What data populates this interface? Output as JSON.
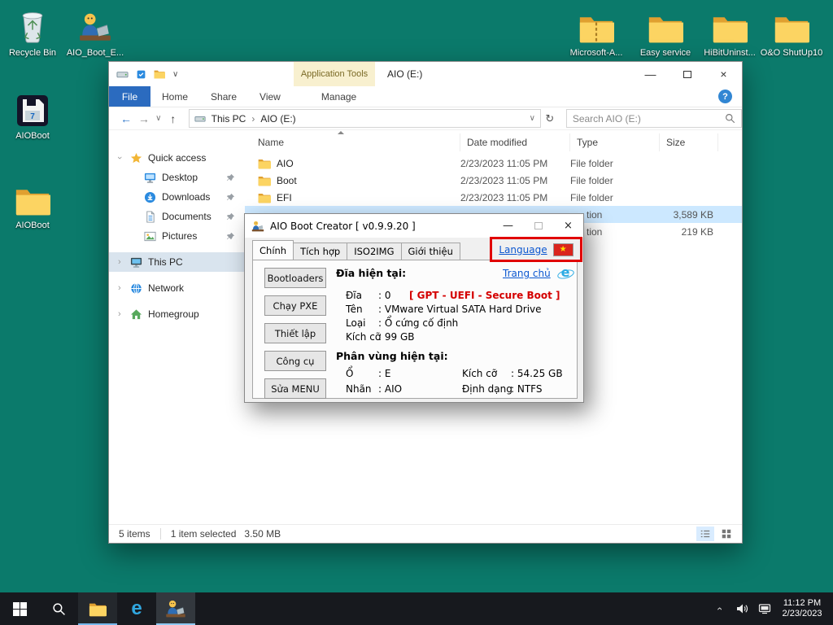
{
  "colors": {
    "desktop_bg": "#0b7a6b",
    "taskbar_bg": "#17191e",
    "highlight_box_red": "#e10000",
    "alert_text_red": "#d40000",
    "link_blue": "#0b57d0",
    "selection_blue": "#cce8ff",
    "file_tab_blue": "#2b6bbf",
    "flag_red": "#da251d",
    "flag_star_yellow": "#ffde00"
  },
  "glyphs": {
    "back": "←",
    "forward": "→",
    "recent": "∨",
    "up": "↑",
    "refresh": "↻",
    "crumb": "›",
    "dropdown": "∨",
    "minimize": "—",
    "close": "×",
    "help": "?",
    "star": "★",
    "edge_e": "e",
    "expander": "›"
  },
  "desktop_icons": {
    "recycle_bin": "Recycle Bin",
    "aio_boot_shortcut": "AIO_Boot_E...",
    "aioboot_app": "AIOBoot",
    "aioboot_folder": "AIOBoot",
    "microsoft": "Microsoft-A...",
    "easy_service": "Easy service",
    "hibit": "HiBitUninst...",
    "oo_shutup": "O&O ShutUp10"
  },
  "explorer": {
    "app_tools_label": "Application Tools",
    "window_title": "AIO (E:)",
    "ribbon": {
      "file": "File",
      "tabs": [
        "Home",
        "Share",
        "View"
      ],
      "manage": "Manage"
    },
    "breadcrumb": [
      "This PC",
      "AIO (E:)"
    ],
    "search_placeholder": "Search AIO (E:)",
    "sidebar": {
      "quick_access": "Quick access",
      "pinned": [
        "Desktop",
        "Downloads",
        "Documents",
        "Pictures"
      ],
      "this_pc": "This PC",
      "network": "Network",
      "homegroup": "Homegroup"
    },
    "columns": {
      "name": "Name",
      "date": "Date modified",
      "type": "Type",
      "size": "Size"
    },
    "rows": [
      {
        "name": "AIO",
        "date": "2/23/2023 11:05 PM",
        "type": "File folder",
        "size": ""
      },
      {
        "name": "Boot",
        "date": "2/23/2023 11:05 PM",
        "type": "File folder",
        "size": ""
      },
      {
        "name": "EFI",
        "date": "2/23/2023 11:05 PM",
        "type": "File folder",
        "size": ""
      },
      {
        "name": "",
        "date": "",
        "type": "tion",
        "size": "3,589 KB"
      },
      {
        "name": "",
        "date": "",
        "type": "tion",
        "size": "219 KB"
      }
    ],
    "status_left": "5 items",
    "status_selected": "1 item selected   3.50 MB"
  },
  "dialog": {
    "title": "AIO Boot Creator [ v0.9.9.20 ]",
    "tabs": [
      "Chính",
      "Tích hợp",
      "ISO2IMG",
      "Giới thiệu"
    ],
    "language_link": "Language",
    "buttons": [
      "Bootloaders",
      "Chạy PXE",
      "Thiết lập",
      "Công cụ",
      "Sửa MENU"
    ],
    "current_disk_heading": "Đĩa hiện tại:",
    "home_link": "Trang chủ",
    "disk": {
      "rows": [
        {
          "label": "Đĩa",
          "value": ": 0"
        },
        {
          "label": "Tên",
          "value": ": VMware Virtual SATA Hard Drive"
        },
        {
          "label": "Loại",
          "value": ": Ổ cứng cố định"
        },
        {
          "label": "Kích cỡ",
          "value": ": 99 GB"
        }
      ],
      "boot_mode": "[ GPT - UEFI - Secure Boot ]"
    },
    "partition_heading": "Phân vùng hiện tại:",
    "partition": [
      {
        "l1": "Ổ",
        "v1": ": E",
        "l2": "Kích cỡ",
        "v2": ": 54.25 GB"
      },
      {
        "l1": "Nhãn",
        "v1": ": AIO",
        "l2": "Định dạng",
        "v2": ": NTFS"
      }
    ]
  },
  "taskbar": {
    "time": "11:12 PM",
    "date": "2/23/2023"
  }
}
